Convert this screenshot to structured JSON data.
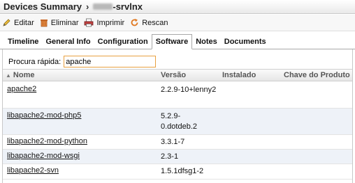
{
  "window": {
    "title": "Devices Summary",
    "separator": "›",
    "host_suffix": "-srvlnx"
  },
  "toolbar": {
    "edit_label": "Editar",
    "delete_label": "Eliminar",
    "print_label": "Imprimir",
    "rescan_label": "Rescan"
  },
  "tabs": [
    {
      "label": "Timeline",
      "active": false
    },
    {
      "label": "General Info",
      "active": false
    },
    {
      "label": "Configuration",
      "active": false
    },
    {
      "label": "Software",
      "active": true
    },
    {
      "label": "Notes",
      "active": false
    },
    {
      "label": "Documents",
      "active": false
    }
  ],
  "search": {
    "label": "Procura rápida:",
    "value": "apache"
  },
  "table": {
    "columns": [
      "Nome",
      "Versão",
      "Instalado",
      "Chave do Produto"
    ],
    "rows": [
      {
        "name": "apache2",
        "version": "2.2.9-10+lenny2"
      },
      {
        "name": "libapache2-mod-php5",
        "version": "5.2.9-0.dotdeb.2"
      },
      {
        "name": "libapache2-mod-python",
        "version": "3.3.1-7"
      },
      {
        "name": "libapache2-mod-wsgi",
        "version": "2.3-1"
      },
      {
        "name": "libapache2-svn",
        "version": "1.5.1dfsg1-2"
      }
    ]
  },
  "colors": {
    "search_border": "#e8a040",
    "alt_row": "#eef2f8"
  }
}
